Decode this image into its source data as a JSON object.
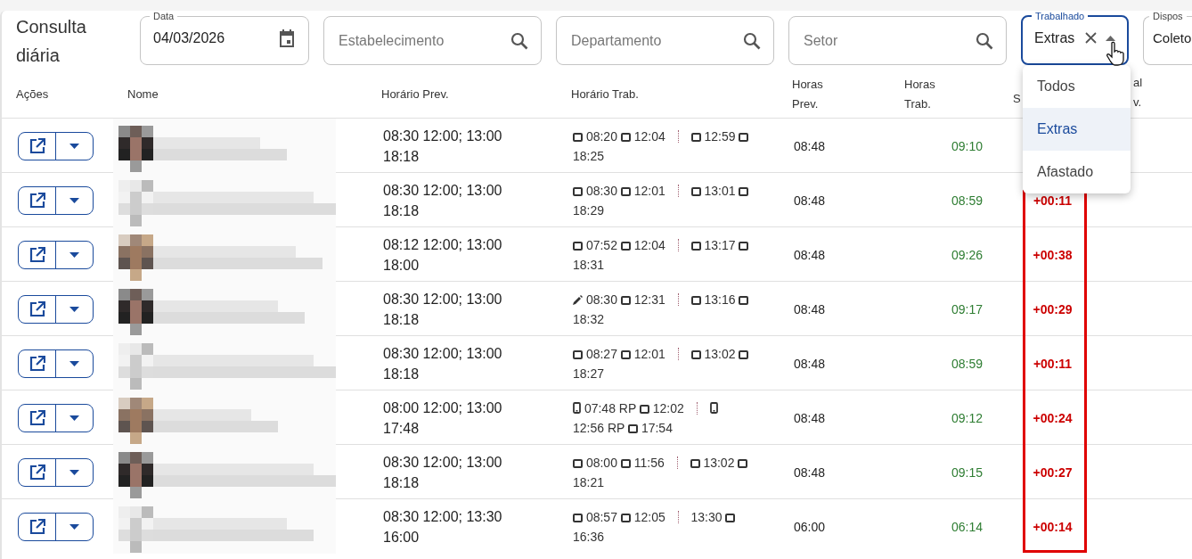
{
  "page": {
    "title": "Consulta diária"
  },
  "filters": [
    {
      "kind": "date",
      "label": "Data",
      "value": "04/03/2026"
    },
    {
      "kind": "search",
      "placeholder": "Estabelecimento"
    },
    {
      "kind": "search",
      "placeholder": "Departamento"
    },
    {
      "kind": "search",
      "placeholder": "Setor"
    },
    {
      "kind": "select",
      "label": "Trabalhado",
      "value": "Extras",
      "expanded": true
    },
    {
      "kind": "select_cut",
      "label": "Dispos",
      "value": "Coleto"
    }
  ],
  "dropdown_options": [
    {
      "label": "Todos",
      "selected": false
    },
    {
      "label": "Extras",
      "selected": true
    },
    {
      "label": "Afastado",
      "selected": false
    }
  ],
  "table": {
    "columns": [
      "Ações",
      "Nome",
      "Horário Prev.",
      "Horário Trab.",
      "Horas Prev.",
      "Horas Trab.",
      "S",
      "al v."
    ],
    "rows": [
      {
        "name": {
          "kind": "picture"
        },
        "prev": "08:30 12:00; 13:00 18:18",
        "punches": [
          {
            "kind": "clock",
            "time": "08:20"
          },
          {
            "kind": "clock",
            "time": "12:04"
          },
          {
            "kind": "separator"
          },
          {
            "kind": "clock",
            "time": "12:59"
          },
          {
            "kind": "clock",
            "time": "18:25"
          }
        ],
        "hours_prev": "08:48",
        "hours_worked": "09:10"
      },
      {
        "name": {
          "kind": "picture"
        },
        "prev": "08:30 12:00; 13:00 18:18",
        "punches": [
          {
            "kind": "clock",
            "time": "08:30"
          },
          {
            "kind": "clock",
            "time": "12:01"
          },
          {
            "kind": "separator"
          },
          {
            "kind": "clock",
            "time": "13:01"
          },
          {
            "kind": "clock",
            "time": "18:29"
          }
        ],
        "hours_prev": "08:48",
        "hours_worked": "08:59",
        "balance": "+00:11"
      },
      {
        "name": {
          "kind": "picture"
        },
        "prev": "08:12 12:00; 13:00 18:00",
        "punches": [
          {
            "kind": "clock",
            "time": "07:52"
          },
          {
            "kind": "clock",
            "time": "12:04"
          },
          {
            "kind": "separator"
          },
          {
            "kind": "clock",
            "time": "13:17"
          },
          {
            "kind": "clock",
            "time": "18:31"
          }
        ],
        "hours_prev": "08:48",
        "hours_worked": "09:26",
        "balance": "+00:38"
      },
      {
        "name": {
          "kind": "picture"
        },
        "prev": "08:30 12:00; 13:00 18:18",
        "punches": [
          {
            "kind": "pencil",
            "time": "08:30"
          },
          {
            "kind": "clock",
            "time": "12:31"
          },
          {
            "kind": "separator"
          },
          {
            "kind": "clock",
            "time": "13:16"
          },
          {
            "kind": "clock",
            "time": "18:32"
          }
        ],
        "hours_prev": "08:48",
        "hours_worked": "09:17",
        "balance": "+00:29"
      },
      {
        "name": {
          "kind": "picture"
        },
        "prev": "08:30 12:00; 13:00 18:18",
        "punches": [
          {
            "kind": "clock",
            "time": "08:27"
          },
          {
            "kind": "clock",
            "time": "12:01"
          },
          {
            "kind": "separator"
          },
          {
            "kind": "clock",
            "time": "13:02"
          },
          {
            "kind": "clock",
            "time": "18:27"
          }
        ],
        "hours_prev": "08:48",
        "hours_worked": "08:59",
        "balance": "+00:11"
      },
      {
        "name": {
          "kind": "picture"
        },
        "prev": "08:00 12:00; 13:00 17:48",
        "punches": [
          {
            "kind": "phone",
            "time": "07:48 RP"
          },
          {
            "kind": "clock",
            "time": "12:02"
          },
          {
            "kind": "separator"
          },
          {
            "kind": "phone",
            "time": "12:56 RP"
          },
          {
            "kind": "clock",
            "time": "17:54"
          }
        ],
        "hours_prev": "08:48",
        "hours_worked": "09:12",
        "balance": "+00:24"
      },
      {
        "name": {
          "kind": "picture"
        },
        "prev": "08:30 12:00; 13:00 18:18",
        "punches": [
          {
            "kind": "clock",
            "time": "08:00"
          },
          {
            "kind": "clock",
            "time": "11:56"
          },
          {
            "kind": "separator"
          },
          {
            "kind": "clock",
            "time": "13:02"
          },
          {
            "kind": "clock",
            "time": "18:21"
          }
        ],
        "hours_prev": "08:48",
        "hours_worked": "09:15",
        "balance": "+00:27"
      },
      {
        "name": {
          "kind": "picture"
        },
        "prev": "08:30 12:00; 13:30 16:00",
        "punches": [
          {
            "kind": "clock",
            "time": "08:57"
          },
          {
            "kind": "clock",
            "time": "12:05"
          },
          {
            "kind": "separator"
          },
          {
            "kind": "none",
            "time": "13:30"
          },
          {
            "kind": "clock",
            "time": "16:36"
          }
        ],
        "hours_prev": "06:00",
        "hours_worked": "06:14",
        "balance": "+00:14"
      }
    ]
  },
  "annotation": {
    "kind": "highlight"
  }
}
